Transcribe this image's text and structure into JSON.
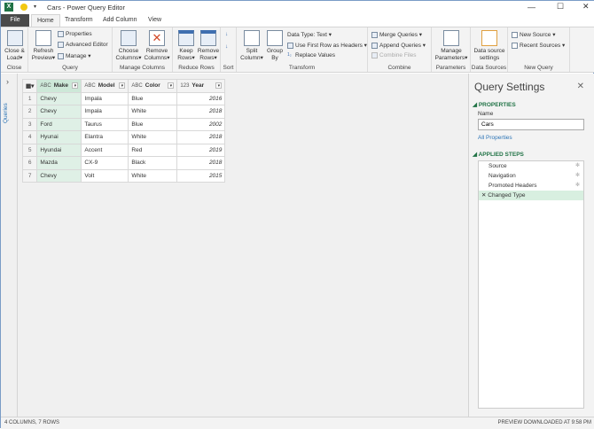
{
  "title": "Cars - Power Query Editor",
  "tabs": [
    "File",
    "Home",
    "Transform",
    "Add Column",
    "View"
  ],
  "ribbon": {
    "close": {
      "close_load": "Close &",
      "close_load2": "Load",
      "label": "Close"
    },
    "query": {
      "refresh": "Refresh",
      "refresh2": "Preview",
      "properties": "Properties",
      "advanced": "Advanced Editor",
      "manage": "Manage",
      "label": "Query"
    },
    "manage_columns": {
      "choose": "Choose",
      "choose2": "Columns",
      "remove": "Remove",
      "remove2": "Columns",
      "label": "Manage Columns"
    },
    "reduce_rows": {
      "keep": "Keep",
      "keep2": "Rows",
      "remove": "Remove",
      "remove2": "Rows",
      "label": "Reduce Rows"
    },
    "sort": {
      "label": "Sort"
    },
    "transform": {
      "split": "Split",
      "split2": "Column",
      "group": "Group",
      "group2": "By",
      "data_type": "Data Type: Text",
      "first_row": "Use First Row as Headers",
      "replace": "Replace Values",
      "label": "Transform"
    },
    "combine": {
      "merge": "Merge Queries",
      "append": "Append Queries",
      "combine_files": "Combine Files",
      "label": "Combine"
    },
    "parameters": {
      "manage": "Manage",
      "manage2": "Parameters",
      "label": "Parameters"
    },
    "data_sources": {
      "settings": "Data source",
      "settings2": "settings",
      "label": "Data Sources"
    },
    "new_query": {
      "new_source": "New Source",
      "recent": "Recent Sources",
      "label": "New Query"
    }
  },
  "queries_pane": {
    "label": "Queries"
  },
  "table": {
    "columns": [
      {
        "type": "ABC",
        "name": "Make"
      },
      {
        "type": "ABC",
        "name": "Model"
      },
      {
        "type": "ABC",
        "name": "Color"
      },
      {
        "type": "123",
        "name": "Year"
      }
    ],
    "rows": [
      [
        "1",
        "Chevy",
        "Impala",
        "Blue",
        "2016"
      ],
      [
        "2",
        "Chevy",
        "Impala",
        "White",
        "2018"
      ],
      [
        "3",
        "Ford",
        "Taurus",
        "Blue",
        "2002"
      ],
      [
        "4",
        "Hyunai",
        "Elantra",
        "White",
        "2018"
      ],
      [
        "5",
        "Hyundai",
        "Accent",
        "Red",
        "2019"
      ],
      [
        "6",
        "Mazda",
        "CX-9",
        "Black",
        "2018"
      ],
      [
        "7",
        "Chevy",
        "Volt",
        "White",
        "2015"
      ]
    ]
  },
  "query_settings": {
    "title": "Query Settings",
    "properties": "PROPERTIES",
    "name_label": "Name",
    "name_value": "Cars",
    "all_properties": "All Properties",
    "applied_steps": "APPLIED STEPS",
    "steps": [
      "Source",
      "Navigation",
      "Promoted Headers",
      "Changed Type"
    ]
  },
  "status": {
    "left": "4 COLUMNS, 7 ROWS",
    "right": "PREVIEW DOWNLOADED AT 9:58 PM"
  }
}
